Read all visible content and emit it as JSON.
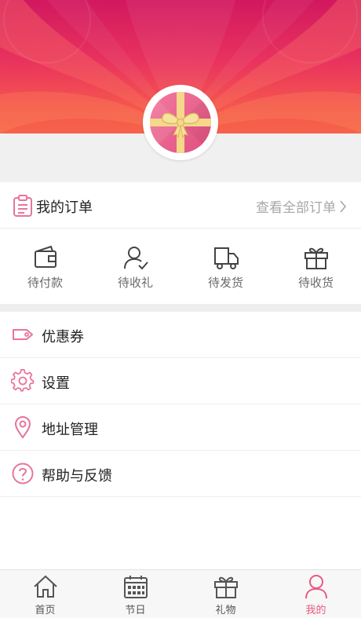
{
  "colors": {
    "accent": "#e85a82",
    "icon_pink": "#e8749a",
    "icon_gray": "#555555"
  },
  "profile": {
    "avatar_icon": "gift-box-icon"
  },
  "orders": {
    "title": "我的订单",
    "view_all": "查看全部订单",
    "statuses": [
      {
        "label": "待付款",
        "icon": "wallet-icon"
      },
      {
        "label": "待收礼",
        "icon": "user-check-icon"
      },
      {
        "label": "待发货",
        "icon": "truck-icon"
      },
      {
        "label": "待收货",
        "icon": "gift-icon"
      }
    ]
  },
  "menu": [
    {
      "label": "优惠券",
      "icon": "coupon-tag-icon"
    },
    {
      "label": "设置",
      "icon": "gear-icon"
    },
    {
      "label": "地址管理",
      "icon": "location-pin-icon"
    },
    {
      "label": "帮助与反馈",
      "icon": "help-icon"
    }
  ],
  "tabbar": [
    {
      "label": "首页",
      "icon": "home-icon"
    },
    {
      "label": "节日",
      "icon": "calendar-icon"
    },
    {
      "label": "礼物",
      "icon": "gift-icon"
    },
    {
      "label": "我的",
      "icon": "user-icon",
      "active": true
    }
  ]
}
